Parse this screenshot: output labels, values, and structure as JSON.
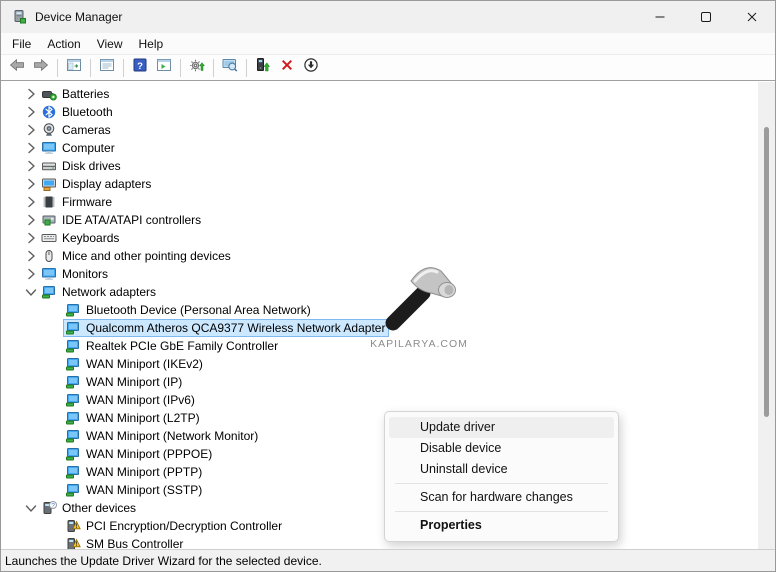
{
  "window": {
    "title": "Device Manager"
  },
  "window_controls": {
    "minimize": "minimize",
    "maximize": "maximize",
    "close": "close"
  },
  "menu_bar": {
    "items": [
      "File",
      "Action",
      "View",
      "Help"
    ]
  },
  "toolbar": {
    "buttons": [
      {
        "name": "back"
      },
      {
        "name": "forward"
      },
      {
        "sep": true
      },
      {
        "name": "show-console-tree"
      },
      {
        "sep": true
      },
      {
        "name": "properties"
      },
      {
        "sep": true
      },
      {
        "name": "help"
      },
      {
        "name": "action-pane"
      },
      {
        "sep": true
      },
      {
        "name": "scan-hardware-changes"
      },
      {
        "sep": true
      },
      {
        "name": "remote-computer"
      },
      {
        "sep": true
      },
      {
        "name": "update-driver"
      },
      {
        "name": "uninstall-device"
      },
      {
        "name": "disable-device"
      }
    ]
  },
  "tree": {
    "items": [
      {
        "label": "Batteries",
        "level": 1,
        "expander": "collapsed",
        "icon": "battery"
      },
      {
        "label": "Bluetooth",
        "level": 1,
        "expander": "collapsed",
        "icon": "bluetooth"
      },
      {
        "label": "Cameras",
        "level": 1,
        "expander": "collapsed",
        "icon": "camera"
      },
      {
        "label": "Computer",
        "level": 1,
        "expander": "collapsed",
        "icon": "computer"
      },
      {
        "label": "Disk drives",
        "level": 1,
        "expander": "collapsed",
        "icon": "disk-drive"
      },
      {
        "label": "Display adapters",
        "level": 1,
        "expander": "collapsed",
        "icon": "display-adapter"
      },
      {
        "label": "Firmware",
        "level": 1,
        "expander": "collapsed",
        "icon": "firmware"
      },
      {
        "label": "IDE ATA/ATAPI controllers",
        "level": 1,
        "expander": "collapsed",
        "icon": "ide-controller"
      },
      {
        "label": "Keyboards",
        "level": 1,
        "expander": "collapsed",
        "icon": "keyboard"
      },
      {
        "label": "Mice and other pointing devices",
        "level": 1,
        "expander": "collapsed",
        "icon": "mouse"
      },
      {
        "label": "Monitors",
        "level": 1,
        "expander": "collapsed",
        "icon": "monitor"
      },
      {
        "label": "Network adapters",
        "level": 1,
        "expander": "expanded",
        "icon": "network-adapter"
      },
      {
        "label": "Bluetooth Device (Personal Area Network)",
        "level": 2,
        "icon": "network-adapter"
      },
      {
        "label": "Qualcomm Atheros QCA9377 Wireless Network Adapter",
        "level": 2,
        "icon": "network-adapter",
        "selected": true
      },
      {
        "label": "Realtek PCIe GbE Family Controller",
        "level": 2,
        "icon": "network-adapter"
      },
      {
        "label": "WAN Miniport (IKEv2)",
        "level": 2,
        "icon": "network-adapter"
      },
      {
        "label": "WAN Miniport (IP)",
        "level": 2,
        "icon": "network-adapter"
      },
      {
        "label": "WAN Miniport (IPv6)",
        "level": 2,
        "icon": "network-adapter"
      },
      {
        "label": "WAN Miniport (L2TP)",
        "level": 2,
        "icon": "network-adapter"
      },
      {
        "label": "WAN Miniport (Network Monitor)",
        "level": 2,
        "icon": "network-adapter"
      },
      {
        "label": "WAN Miniport (PPPOE)",
        "level": 2,
        "icon": "network-adapter"
      },
      {
        "label": "WAN Miniport (PPTP)",
        "level": 2,
        "icon": "network-adapter"
      },
      {
        "label": "WAN Miniport (SSTP)",
        "level": 2,
        "icon": "network-adapter"
      },
      {
        "label": "Other devices",
        "level": 1,
        "expander": "expanded",
        "icon": "unknown-device"
      },
      {
        "label": "PCI Encryption/Decryption Controller",
        "level": 2,
        "icon": "warning-device"
      },
      {
        "label": "SM Bus Controller",
        "level": 2,
        "icon": "warning-device"
      }
    ]
  },
  "context_menu": {
    "items": [
      {
        "label": "Update driver",
        "highlighted": true
      },
      {
        "label": "Disable device"
      },
      {
        "label": "Uninstall device"
      },
      {
        "type": "separator"
      },
      {
        "label": "Scan for hardware changes"
      },
      {
        "type": "separator"
      },
      {
        "label": "Properties",
        "bold": true
      }
    ]
  },
  "watermark": {
    "text": "KAPILARYA.COM"
  },
  "status_bar": {
    "text": "Launches the Update Driver Wizard for the selected device."
  },
  "colors": {
    "selection_bg": "#cce8ff",
    "selection_border": "#7fb9ef",
    "menu_highlight": "#efefef",
    "accent_green": "#2fae2f",
    "warning_yellow": "#fbc02d",
    "uninstall_red": "#cf1b1b"
  }
}
